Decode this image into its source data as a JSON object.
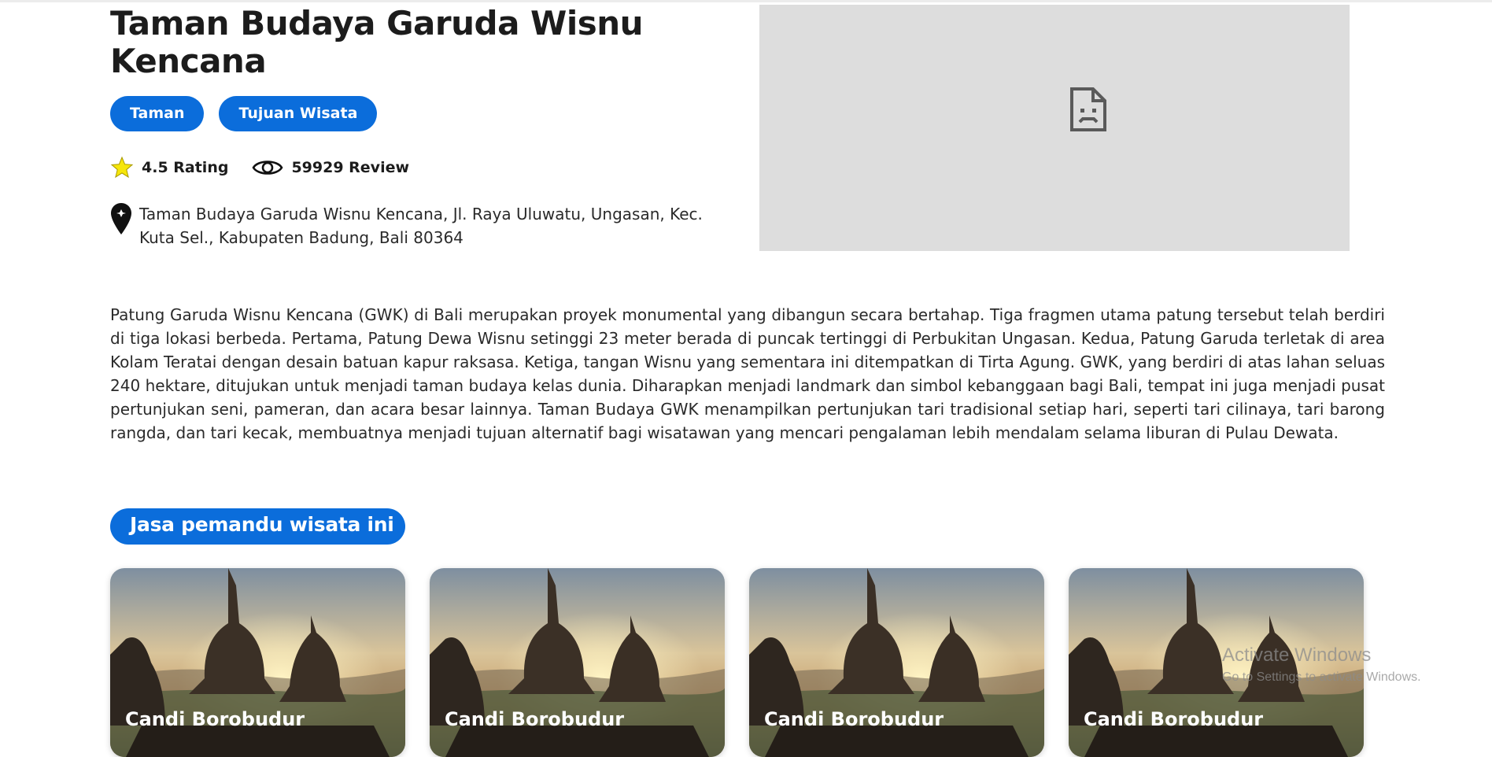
{
  "place": {
    "title": "Taman Budaya Garuda Wisnu Kencana",
    "tags": [
      "Taman",
      "Tujuan Wisata"
    ],
    "rating_label": "4.5 Rating",
    "review_label": "59929 Review",
    "address": "Taman Budaya Garuda Wisnu Kencana, Jl. Raya Uluwatu, Ungasan, Kec. Kuta Sel., Kabupaten Badung, Bali 80364",
    "description": "Patung Garuda Wisnu Kencana (GWK) di Bali merupakan proyek monumental yang dibangun secara bertahap. Tiga fragmen utama patung tersebut telah berdiri di tiga lokasi berbeda. Pertama, Patung Dewa Wisnu setinggi 23 meter berada di puncak tertinggi di Perbukitan Ungasan. Kedua, Patung Garuda terletak di area Kolam Teratai dengan desain batuan kapur raksasa. Ketiga, tangan Wisnu yang sementara ini ditempatkan di Tirta Agung. GWK, yang berdiri di atas lahan seluas 240 hektare, ditujukan untuk menjadi taman budaya kelas dunia. Diharapkan menjadi landmark dan simbol kebanggaan bagi Bali, tempat ini juga menjadi pusat pertunjukan seni, pameran, dan acara besar lainnya. Taman Budaya GWK menampilkan pertunjukan tari tradisional setiap hari, seperti tari cilinaya, tari barong rangda, dan tari kecak, membuatnya menjadi tujuan alternatif bagi wisatawan yang mencari pengalaman lebih mendalam selama liburan di Pulau Dewata.",
    "media_icon": "broken-image-icon"
  },
  "guides": {
    "section_label": "Jasa pemandu wisata ini",
    "cards": [
      {
        "title": "Candi Borobudur"
      },
      {
        "title": "Candi Borobudur"
      },
      {
        "title": "Candi Borobudur"
      },
      {
        "title": "Candi Borobudur"
      }
    ]
  },
  "watermark": {
    "title": "Activate Windows",
    "subtitle": "Go to Settings to activate Windows."
  },
  "icons": {
    "rating": "star-icon",
    "reviews": "eye-icon",
    "address": "map-pin-icon"
  },
  "colors": {
    "accent": "#0b6ddb",
    "star": "#f6e60a",
    "media_bg": "#dddddd",
    "text": "#1c1c1c"
  }
}
